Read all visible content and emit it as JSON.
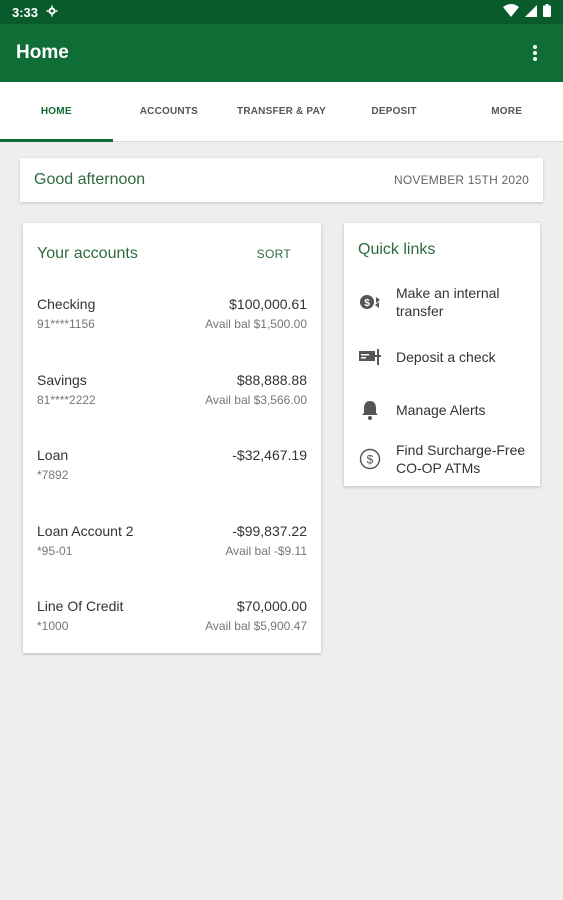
{
  "status": {
    "time": "3:33"
  },
  "appbar": {
    "title": "Home"
  },
  "tabs": [
    {
      "label": "HOME",
      "active": true
    },
    {
      "label": "ACCOUNTS"
    },
    {
      "label": "TRANSFER & PAY"
    },
    {
      "label": "DEPOSIT"
    },
    {
      "label": "MORE"
    }
  ],
  "greeting": {
    "text": "Good afternoon",
    "date": "NOVEMBER 15TH 2020"
  },
  "accounts": {
    "title": "Your accounts",
    "sort_label": "SORT",
    "items": [
      {
        "name": "Checking",
        "number": "91****1156",
        "balance": "$100,000.61",
        "available": "Avail bal $1,500.00"
      },
      {
        "name": "Savings",
        "number": "81****2222",
        "balance": "$88,888.88",
        "available": "Avail bal $3,566.00"
      },
      {
        "name": "Loan",
        "number": "*7892",
        "balance": "-$32,467.19",
        "available": ""
      },
      {
        "name": "Loan Account 2",
        "number": "*95-01",
        "balance": "-$99,837.22",
        "available": "Avail bal -$9.11"
      },
      {
        "name": "Line Of Credit",
        "number": "*1000",
        "balance": "$70,000.00",
        "available": "Avail bal $5,900.47"
      }
    ]
  },
  "quick_links": {
    "title": "Quick links",
    "items": [
      {
        "label": "Make an internal transfer",
        "icon": "transfer-icon"
      },
      {
        "label": "Deposit a check",
        "icon": "check-deposit-icon"
      },
      {
        "label": "Manage Alerts",
        "icon": "bell-icon"
      },
      {
        "label": "Find Surcharge-Free CO-OP ATMs",
        "icon": "dollar-circle-icon"
      }
    ]
  },
  "colors": {
    "status_bar": "#0a5b2c",
    "app_bar": "#0e6e35",
    "accent_text": "#2f6b3f",
    "background": "#eeeeee"
  }
}
